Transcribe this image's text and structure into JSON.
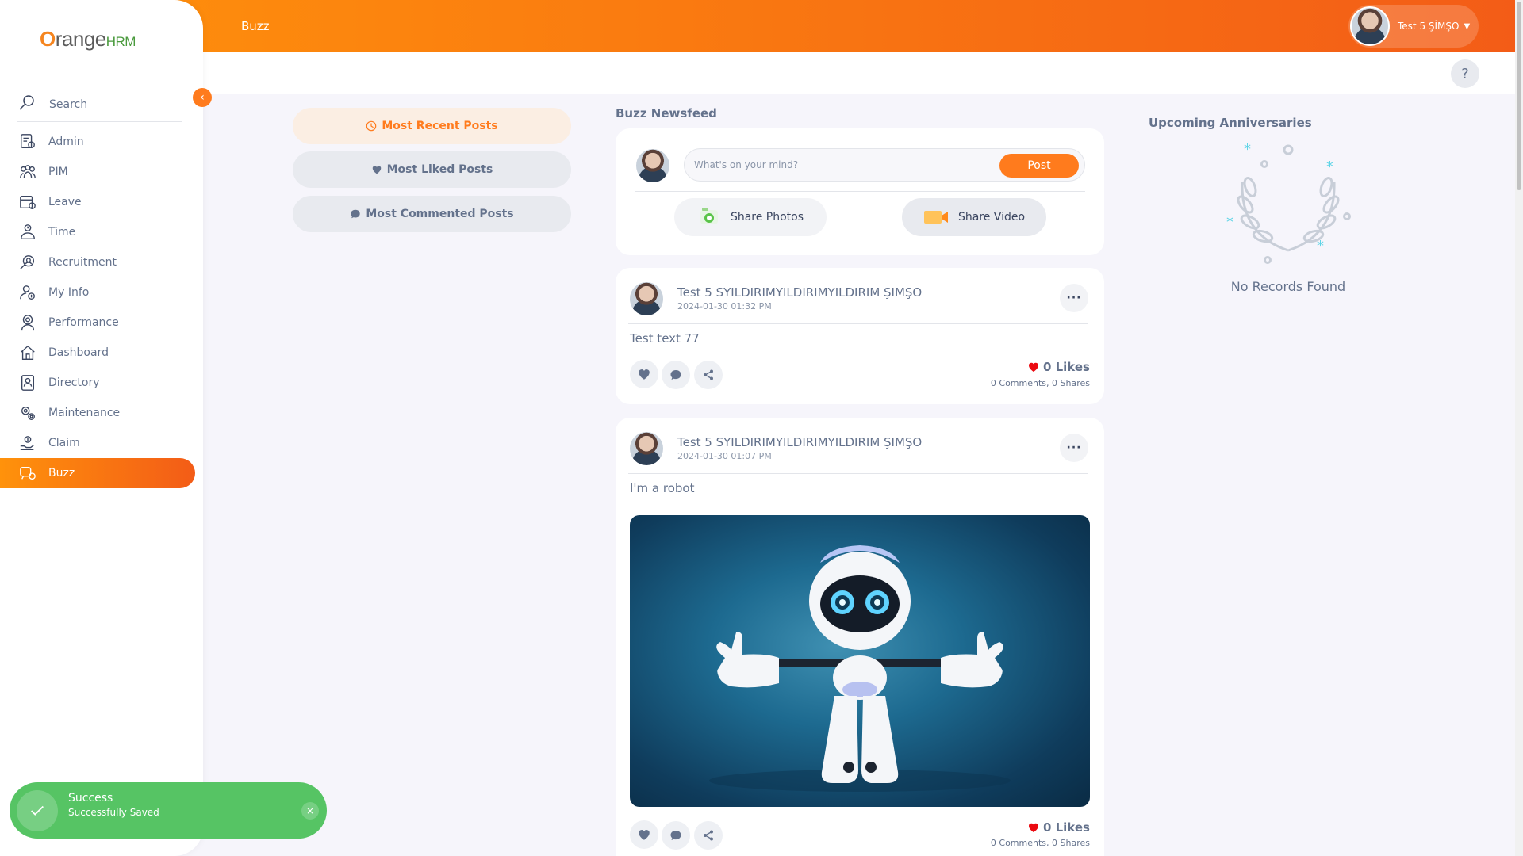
{
  "brand": {
    "logo_text": "OrangeHRM"
  },
  "header": {
    "title": "Buzz",
    "user_name": "Test 5 ŞİMŞO",
    "help_label": "?"
  },
  "sidebar": {
    "search_label": "Search",
    "items": [
      {
        "label": "Admin",
        "icon": "admin-icon"
      },
      {
        "label": "PIM",
        "icon": "pim-icon"
      },
      {
        "label": "Leave",
        "icon": "leave-icon"
      },
      {
        "label": "Time",
        "icon": "time-icon"
      },
      {
        "label": "Recruitment",
        "icon": "recruitment-icon"
      },
      {
        "label": "My Info",
        "icon": "my-info-icon"
      },
      {
        "label": "Performance",
        "icon": "performance-icon"
      },
      {
        "label": "Dashboard",
        "icon": "dashboard-icon"
      },
      {
        "label": "Directory",
        "icon": "directory-icon"
      },
      {
        "label": "Maintenance",
        "icon": "maintenance-icon"
      },
      {
        "label": "Claim",
        "icon": "claim-icon"
      },
      {
        "label": "Buzz",
        "icon": "buzz-icon",
        "active": true
      }
    ]
  },
  "filters": {
    "most_recent": "Most Recent Posts",
    "most_liked": "Most Liked Posts",
    "most_commented": "Most Commented Posts"
  },
  "newsfeed": {
    "title": "Buzz Newsfeed",
    "composer_placeholder": "What's on your mind?",
    "post_button": "Post",
    "share_photos": "Share Photos",
    "share_video": "Share Video"
  },
  "posts": [
    {
      "author": "Test 5 SYILDIRIMYILDIRIMYILDIRIM ŞIMŞO",
      "time": "2024-01-30 01:32 PM",
      "text": "Test text 77",
      "likes": "0 Likes",
      "comments": "0 Comments",
      "shares": "0 Shares"
    },
    {
      "author": "Test 5 SYILDIRIMYILDIRIMYILDIRIM ŞIMŞO",
      "time": "2024-01-30 01:07 PM",
      "text": "I'm a robot",
      "likes": "0 Likes",
      "comments": "0 Comments",
      "shares": "0 Shares"
    }
  ],
  "anniversaries": {
    "title": "Upcoming Anniversaries",
    "empty": "No Records Found"
  },
  "toast": {
    "title": "Success",
    "message": "Successfully Saved",
    "close": "×"
  },
  "colors": {
    "brand_orange": "#ff7b1d",
    "success_green": "#56c464",
    "text_gray": "#64728c"
  }
}
